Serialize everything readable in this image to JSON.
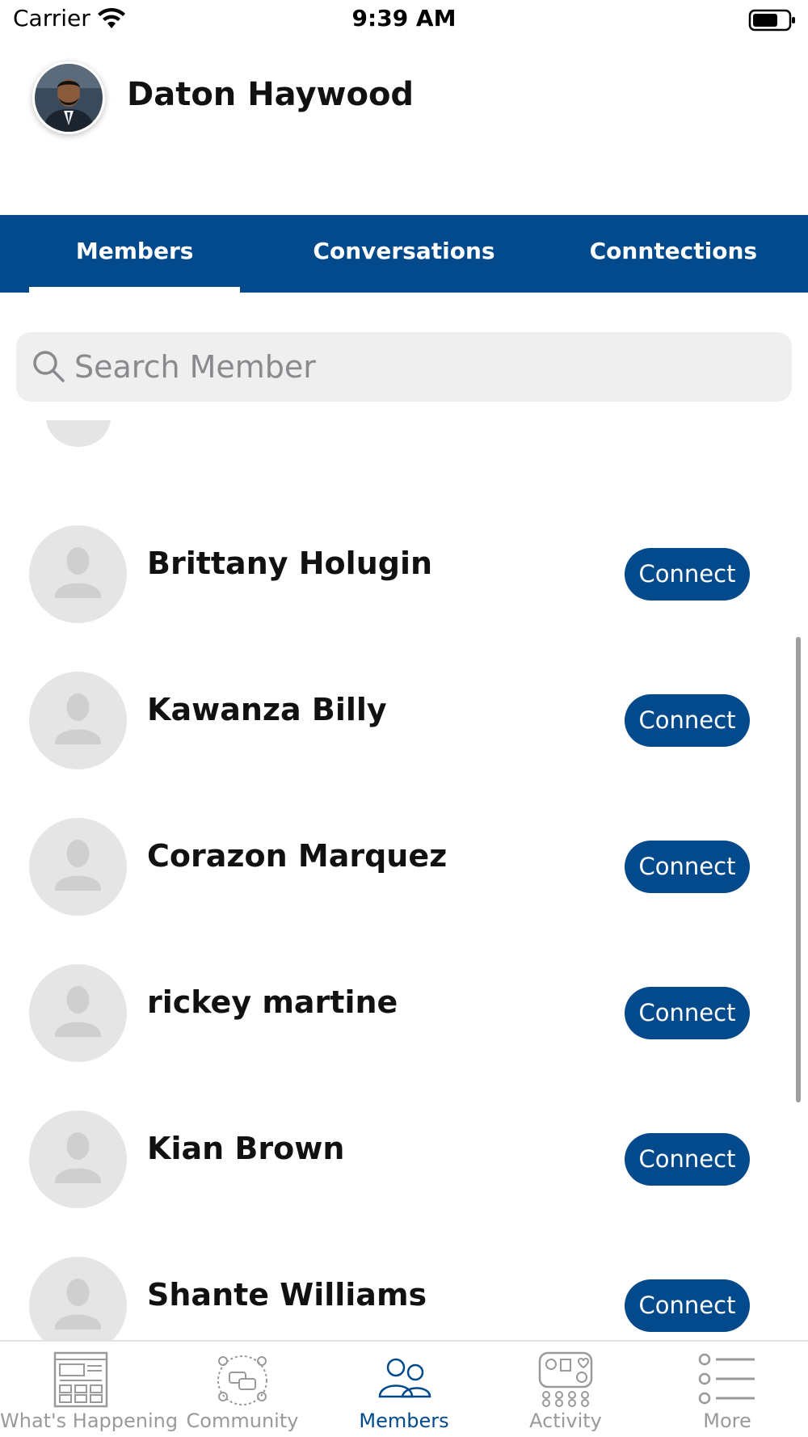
{
  "status_bar": {
    "carrier": "Carrier",
    "time": "9:39 AM"
  },
  "profile": {
    "name": "Daton Haywood"
  },
  "tabs": [
    {
      "label": "Members",
      "active": true
    },
    {
      "label": "Conversations",
      "active": false
    },
    {
      "label": "Conntections",
      "active": false
    }
  ],
  "search": {
    "placeholder": "Search Member",
    "value": ""
  },
  "members": [
    {
      "name": "Brittany Holugin",
      "action": "Connect"
    },
    {
      "name": "Kawanza Billy",
      "action": "Connect"
    },
    {
      "name": "Corazon Marquez",
      "action": "Connect"
    },
    {
      "name": "rickey martine",
      "action": "Connect"
    },
    {
      "name": "Kian Brown",
      "action": "Connect"
    },
    {
      "name": "Shante Williams",
      "action": "Connect"
    }
  ],
  "bottom_nav": [
    {
      "label": "What's Happening",
      "icon": "newspaper-icon",
      "active": false
    },
    {
      "label": "Community",
      "icon": "community-icon",
      "active": false
    },
    {
      "label": "Members",
      "icon": "members-icon",
      "active": true
    },
    {
      "label": "Activity",
      "icon": "activity-icon",
      "active": false
    },
    {
      "label": "More",
      "icon": "list-icon",
      "active": false
    }
  ],
  "colors": {
    "primary": "#034a8c",
    "avatar_placeholder": "#e5e5e5",
    "inactive_nav": "#9a9a9a"
  }
}
